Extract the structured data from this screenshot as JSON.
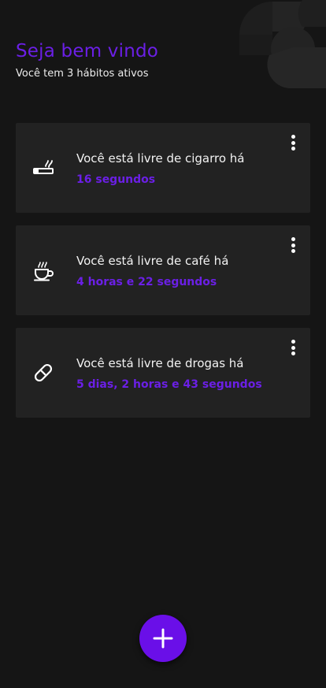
{
  "header": {
    "title": "Seja bem vindo",
    "subtitle": "Você tem 3 hábitos ativos"
  },
  "habits": [
    {
      "icon": "cigarette-icon",
      "label": "Você está livre de cigarro há",
      "value": "16 segundos"
    },
    {
      "icon": "coffee-icon",
      "label": "Você está livre de café há",
      "value": "4 horas e 22 segundos"
    },
    {
      "icon": "pill-icon",
      "label": "Você está livre de drogas há",
      "value": "5 dias, 2 horas e 43 segundos"
    }
  ],
  "colors": {
    "accent": "#6b1fe6",
    "background": "#151515",
    "card": "#222222"
  },
  "fab": {
    "icon": "plus-icon"
  }
}
